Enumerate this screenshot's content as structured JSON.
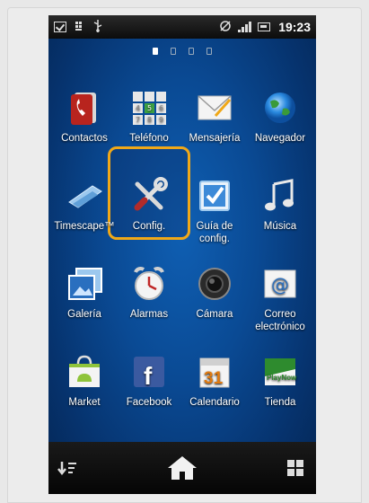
{
  "status_bar": {
    "time": "19:23",
    "icons": [
      "check-notification-icon",
      "sim-icon",
      "usb-icon",
      "gps-icon",
      "signal-icon",
      "battery-icon"
    ]
  },
  "pager": {
    "pages": 4,
    "active": 0
  },
  "apps": [
    {
      "id": "contactos",
      "label": "Contactos",
      "label2": "",
      "icon": "contacts-phone-icon"
    },
    {
      "id": "telefono",
      "label": "Teléfono",
      "label2": "",
      "icon": "dialpad-icon"
    },
    {
      "id": "mensajeria",
      "label": "Mensajería",
      "label2": "",
      "icon": "envelope-icon"
    },
    {
      "id": "navegador",
      "label": "Navegador",
      "label2": "",
      "icon": "globe-icon"
    },
    {
      "id": "timescape",
      "label": "Timescape™",
      "label2": "",
      "icon": "timescape-icon"
    },
    {
      "id": "config",
      "label": "Config.",
      "label2": "",
      "icon": "tools-icon"
    },
    {
      "id": "guia",
      "label": "Guía de",
      "label2": "config.",
      "icon": "checkbox-icon"
    },
    {
      "id": "musica",
      "label": "Música",
      "label2": "",
      "icon": "music-note-icon"
    },
    {
      "id": "galeria",
      "label": "Galería",
      "label2": "",
      "icon": "gallery-icon"
    },
    {
      "id": "alarmas",
      "label": "Alarmas",
      "label2": "",
      "icon": "alarm-clock-icon"
    },
    {
      "id": "camara",
      "label": "Cámara",
      "label2": "",
      "icon": "camera-icon"
    },
    {
      "id": "correo",
      "label": "Correo",
      "label2": "electrónico",
      "icon": "email-at-icon"
    },
    {
      "id": "market",
      "label": "Market",
      "label2": "",
      "icon": "market-bag-icon"
    },
    {
      "id": "facebook",
      "label": "Facebook",
      "label2": "",
      "icon": "facebook-icon"
    },
    {
      "id": "calendario",
      "label": "Calendario",
      "label2": "",
      "icon": "calendar-icon"
    },
    {
      "id": "tienda",
      "label": "Tienda",
      "label2": "",
      "icon": "playnow-icon"
    }
  ],
  "calendar_day": "31",
  "playnow_text": "PlayNow",
  "highlighted_app": "config",
  "highlight_color": "#f0a818",
  "bottom_bar": {
    "left": "sort-icon",
    "center": "home-icon",
    "right": "grid-icon"
  }
}
